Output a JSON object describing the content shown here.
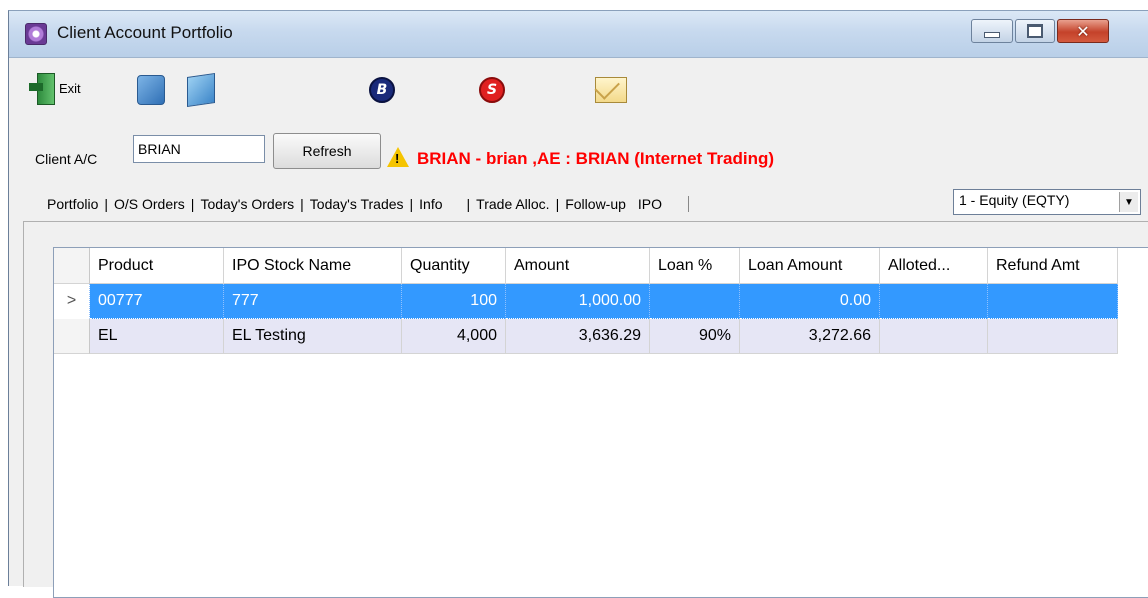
{
  "window": {
    "title": "Client Account Portfolio",
    "close_glyph": "✕"
  },
  "toolbar": {
    "exit_label": "Exit",
    "buy_letter": "B",
    "sell_letter": "S"
  },
  "client": {
    "label": "Client A/C",
    "account_value": "BRIAN",
    "refresh_label": "Refresh",
    "warning_glyph": "!",
    "info_text": "BRIAN - brian ,AE : BRIAN (Internet Trading)"
  },
  "tabs": [
    "Portfolio",
    "O/S Orders",
    "Today's Orders",
    "Today's Trades",
    "Info",
    "Trade Alloc.",
    "Follow-up",
    "IPO"
  ],
  "market_select": {
    "value": "1 - Equity (EQTY)",
    "arrow": "▼"
  },
  "grid": {
    "columns": [
      "",
      "Product",
      "IPO Stock Name",
      "Quantity",
      "Amount",
      "Loan %",
      "Loan Amount",
      "Alloted...",
      "Refund Amt"
    ],
    "rows": [
      {
        "indicator": ">",
        "product": "00777",
        "name": "777",
        "quantity": "100",
        "amount": "1,000.00",
        "loan_pct": "",
        "loan_amount": "0.00",
        "alloted": "",
        "refund": ""
      },
      {
        "indicator": "",
        "product": "EL",
        "name": "EL Testing",
        "quantity": "4,000",
        "amount": "3,636.29",
        "loan_pct": "90%",
        "loan_amount": "3,272.66",
        "alloted": "",
        "refund": ""
      }
    ]
  },
  "colors": {
    "selected_row": "#3399ff",
    "alt_row": "#e6e6f5",
    "warning_text": "#ff0000"
  },
  "icons": [
    "app-icon",
    "exit-icon",
    "transfer-icon",
    "book-icon",
    "buy-icon",
    "sell-icon",
    "mail-icon",
    "warning-icon"
  ]
}
